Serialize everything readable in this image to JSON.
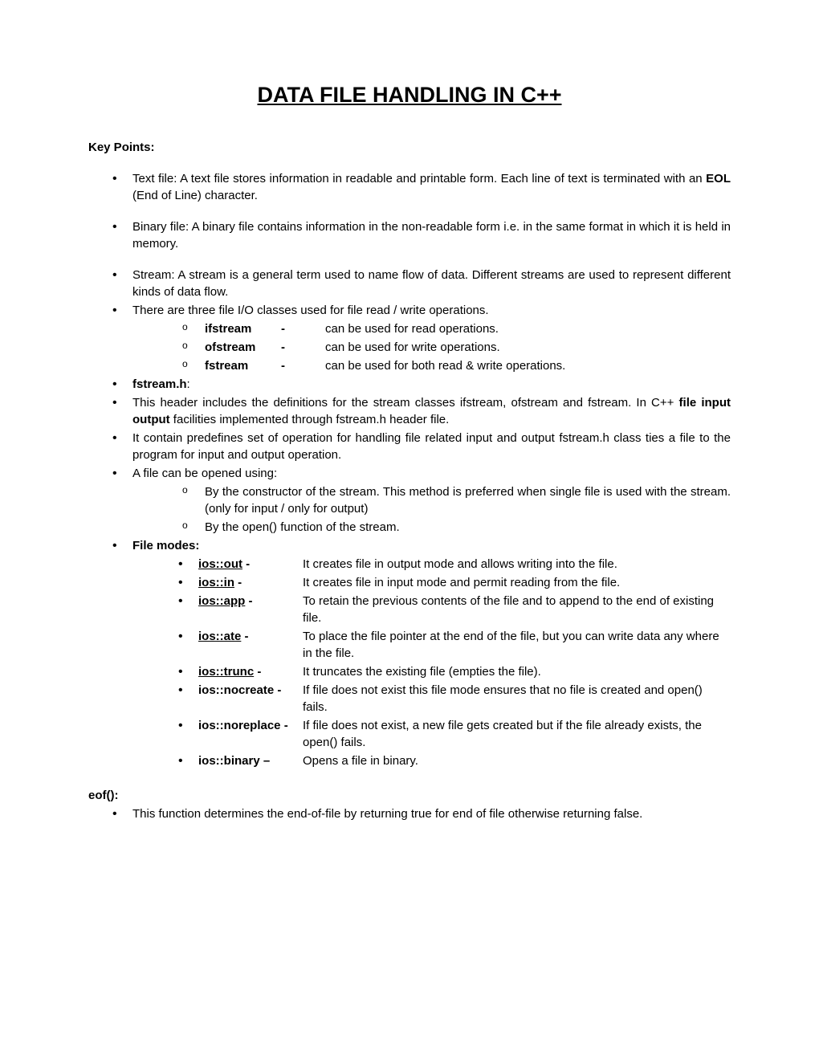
{
  "title": "DATA FILE HANDLING IN C++",
  "keyPoints": "Key Points:",
  "textFile": {
    "pre": "Text file: A text file stores information in readable and printable form. Each line of text is terminated with an ",
    "eol": "EOL",
    "post": " (End of Line) character."
  },
  "binaryFile": "Binary file: A binary file contains information in the non-readable form i.e. in the same format in which it is held in memory.",
  "stream": "Stream: A stream is a general term used to name flow of data. Different streams are used to represent different kinds of data flow.",
  "threeClasses": "There are three file I/O classes used for file read / write operations.",
  "ioClasses": [
    {
      "name": " ifstream",
      "desc": "can be used for read operations."
    },
    {
      "name": "ofstream",
      "desc": "can be used for write operations."
    },
    {
      "name": "fstream",
      "desc": "can be used for both read & write operations."
    }
  ],
  "fstreamH": {
    "bold": "fstream.h",
    "colon": ":"
  },
  "headerInc": {
    "pre": "This header includes the definitions for the stream classes ifstream, ofstream and fstream. In C++ ",
    "bold": "file input output",
    "post": " facilities implemented through fstream.h header file."
  },
  "predefine": " It contain predefines set of operation for handling file related input and output fstream.h class ties a file to the program for input and output operation.",
  "fileOpen": "A file can be opened using:",
  "openWays": [
    "By the constructor of the stream. This method is preferred when single file is used with the stream. (only for input / only for output)",
    "By the open() function of the stream."
  ],
  "fileModes": "File modes:",
  "modes": {
    "out": {
      "name": "ios::out",
      "dash": " -",
      "desc": "It creates file in output mode and allows writing into the file."
    },
    "in": {
      "name": "ios::in",
      "dash": " -",
      "desc": "It creates file in input mode and permit reading from the file."
    },
    "app": {
      "name": "ios::app",
      "dash": " -",
      "desc1": "To retain the previous contents of the file and to append to the end of existing",
      "desc2": "file."
    },
    "ate": {
      "name": "ios::ate",
      "dash": " -",
      "desc1": "To place the file pointer at the end of the file, but you can write data any where",
      "desc2": "in the file."
    },
    "trunc": {
      "name": "ios::trunc",
      "dash": " -",
      "desc": "It truncates the existing file (empties the file)."
    },
    "nocreate": {
      "name": "ios::nocreate -",
      "desc1": "If file does not exist this file mode ensures that no file is created and open()",
      "desc2": "fails."
    },
    "noreplace": {
      "name": "ios::noreplace -",
      "desc1": "If file does not exist, a new file gets created but if the file already exists, the",
      "desc2": "open() fails."
    },
    "binary": {
      "name": "ios::binary –",
      "desc": "Opens a file in binary."
    }
  },
  "eof": {
    "title": "eof():",
    "desc": "This function determines the end-of-file by returning true for end of file otherwise returning false."
  }
}
